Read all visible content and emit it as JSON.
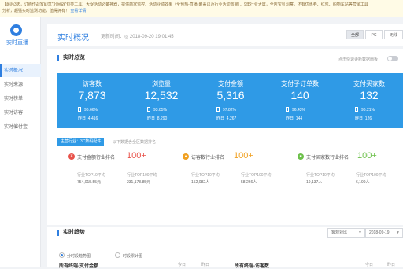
{
  "banner": {
    "text_line1": "【最后3天，订购作战室即享“巩固战”包类工具】大促活动必备神器，提供商家监控、活动业绩效果（全预热-直播-聚盖以及行业活动效果）、9年行业大屏，全店宝贝洞察，还有优惠券、红包、购物车站等营销工具",
    "text_line2": "分析，超强实时监测功能，值得拥有！",
    "link": "查看详情"
  },
  "sidebar": {
    "logo_label": "实时直播",
    "items": [
      {
        "label": "实时概况",
        "active": true
      },
      {
        "label": "实时来源",
        "active": false
      },
      {
        "label": "实时榜单",
        "active": false
      },
      {
        "label": "实时访客",
        "active": false
      },
      {
        "label": "实时催付宝",
        "active": false
      }
    ]
  },
  "header": {
    "title": "实时概况",
    "updated": "更新时间：◎ 2018-09-20 19:01:45",
    "segments": [
      {
        "label": "全部",
        "active": true
      },
      {
        "label": "PC",
        "active": false
      },
      {
        "label": "无线",
        "active": false
      }
    ]
  },
  "overview": {
    "title": "实时总览",
    "help": "点击快速更新数据面板",
    "metrics": [
      {
        "label": "访客数",
        "value": "7,873",
        "pct": "96.66%",
        "yesterday_label": "昨日",
        "yesterday": "4,416"
      },
      {
        "label": "浏览量",
        "value": "12,532",
        "pct": "93.85%",
        "yesterday_label": "昨日",
        "yesterday": "8,290"
      },
      {
        "label": "支付金额",
        "value": "5,316",
        "pct": "97.82%",
        "yesterday_label": "昨日",
        "yesterday": "4,267"
      },
      {
        "label": "支付子订单数",
        "value": "140",
        "pct": "96.43%",
        "yesterday_label": "昨日",
        "yesterday": "144"
      },
      {
        "label": "支付买家数",
        "value": "132",
        "pct": "96.21%",
        "yesterday_label": "昨日",
        "yesterday": "126"
      }
    ]
  },
  "industry": {
    "tag": "主营行业：3C数码配件",
    "note": "以下数据含全区数据排名"
  },
  "rankings": [
    {
      "icon": "¥",
      "icon_color": "#e8524a",
      "label": "支付金额行业排名",
      "value": "100+",
      "value_color": "#e8524a",
      "top_label": "行业TOP10平均",
      "top_value": "754,015.55元",
      "avg_label": "行业TOP100平均",
      "avg_value": "231,178.85元"
    },
    {
      "icon": "♦",
      "icon_color": "#f0a020",
      "label": "访客数行业排名",
      "value": "100+",
      "value_color": "#f0a020",
      "top_label": "行业TOP10平均",
      "top_value": "152,082人",
      "avg_label": "行业TOP100平均",
      "avg_value": "58,266人"
    },
    {
      "icon": "■",
      "icon_color": "#6cc04a",
      "label": "支付买家数行业排名",
      "value": "100+",
      "value_color": "#6cc04a",
      "top_label": "行业TOP10平均",
      "top_value": "19,137人",
      "avg_label": "行业TOP100平均",
      "avg_value": "6,199人"
    }
  ],
  "trend": {
    "title": "实时趋势",
    "select_value": "客观对比",
    "date_value": "2018-09-19",
    "radio_options": [
      {
        "label": "分时段趋势图",
        "checked": true
      },
      {
        "label": "时段累计图",
        "checked": false
      }
    ],
    "chart_left_title": "所有终端-支付金额",
    "chart_right_title": "所有终端-访客数",
    "legend_today": "今日",
    "legend_yesterday": "昨日"
  }
}
